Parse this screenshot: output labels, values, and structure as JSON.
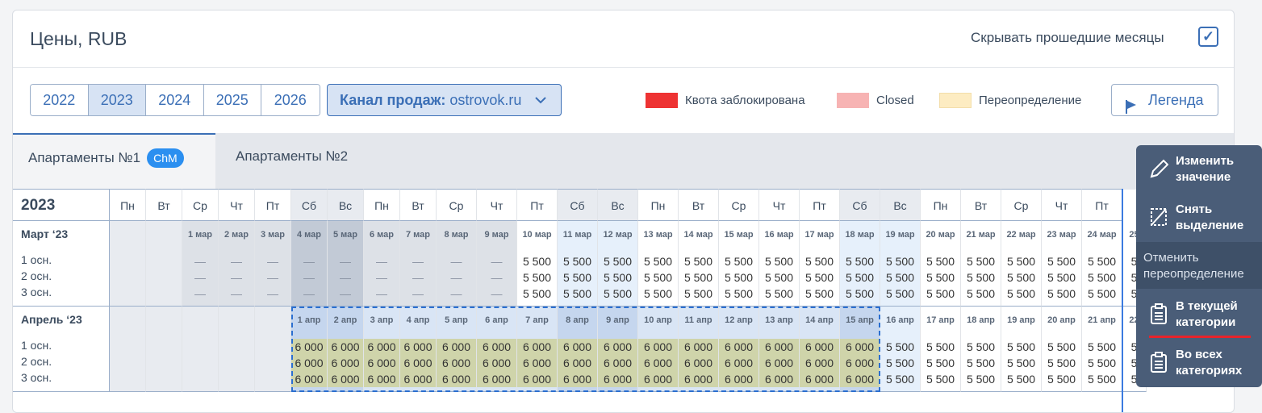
{
  "header": {
    "title": "Цены, RUB",
    "hide_past_label": "Скрывать прошедшие месяцы",
    "hide_past_checked": true
  },
  "years": [
    "2022",
    "2023",
    "2024",
    "2025",
    "2026"
  ],
  "active_year": "2023",
  "channel": {
    "label": "Канал продаж:",
    "value": "ostrovok.ru"
  },
  "legend": [
    {
      "label": "Квота заблокирована",
      "color": "#ee3333"
    },
    {
      "label": "Closed",
      "color": "#f7b3b3"
    },
    {
      "label": "Переопределение",
      "color": "#fdecc2"
    }
  ],
  "legend_button": "Легенда",
  "tabs": [
    {
      "label": "Апартаменты №1",
      "badge": "ChM"
    },
    {
      "label": "Апартаменты №2"
    }
  ],
  "grid": {
    "year": "2023",
    "weekdays": [
      "Пн",
      "Вт",
      "Ср",
      "Чт",
      "Пт",
      "Сб",
      "Вс",
      "Пн",
      "Вт",
      "Ср",
      "Чт",
      "Пт",
      "Сб",
      "Вс",
      "Пн",
      "Вт",
      "Ср",
      "Чт",
      "Пт",
      "Сб",
      "Вс",
      "Пн",
      "Вт",
      "Ср",
      "Чт",
      "Пт"
    ],
    "rooms": [
      "1 осн.",
      "2 осн.",
      "3 осн."
    ],
    "months": [
      {
        "label": "Март ‘23",
        "days": [
          "",
          "",
          "1 мар",
          "2 мар",
          "3 мар",
          "4 мар",
          "5 мар",
          "6 мар",
          "7 мар",
          "8 мар",
          "9 мар",
          "10 мар",
          "11 мар",
          "12 мар",
          "13 мар",
          "14 мар",
          "15 мар",
          "16 мар",
          "17 мар",
          "18 мар",
          "19 мар",
          "20 мар",
          "21 мар",
          "22 мар",
          "23 мар",
          "24 мар",
          "25"
        ],
        "values": [
          "",
          "",
          "—",
          "—",
          "—",
          "—",
          "—",
          "—",
          "—",
          "—",
          "—",
          "5 500",
          "5 500",
          "5 500",
          "5 500",
          "5 500",
          "5 500",
          "5 500",
          "5 500",
          "5 500",
          "5 500",
          "5 500",
          "5 500",
          "5 500",
          "5 500",
          "5 500",
          "5"
        ]
      },
      {
        "label": "Апрель ‘23",
        "days": [
          "",
          "",
          "",
          "",
          "",
          "1 апр",
          "2 апр",
          "3 апр",
          "4 апр",
          "5 апр",
          "6 апр",
          "7 апр",
          "8 апр",
          "9 апр",
          "10 апр",
          "11 апр",
          "12 апр",
          "13 апр",
          "14 апр",
          "15 апр",
          "16 апр",
          "17 апр",
          "18 апр",
          "19 апр",
          "20 апр",
          "21 апр",
          "22"
        ],
        "values": [
          "",
          "",
          "",
          "",
          "",
          "6 000",
          "6 000",
          "6 000",
          "6 000",
          "6 000",
          "6 000",
          "6 000",
          "6 000",
          "6 000",
          "6 000",
          "6 000",
          "6 000",
          "6 000",
          "6 000",
          "6 000",
          "5 500",
          "5 500",
          "5 500",
          "5 500",
          "5 500",
          "5 500",
          "5"
        ]
      }
    ]
  },
  "popup": {
    "edit": "Изменить значение",
    "deselect": "Снять выделение",
    "cancel_override": "Отменить переопределение",
    "in_current": "В текущей категории",
    "in_all": "Во всех категориях"
  }
}
